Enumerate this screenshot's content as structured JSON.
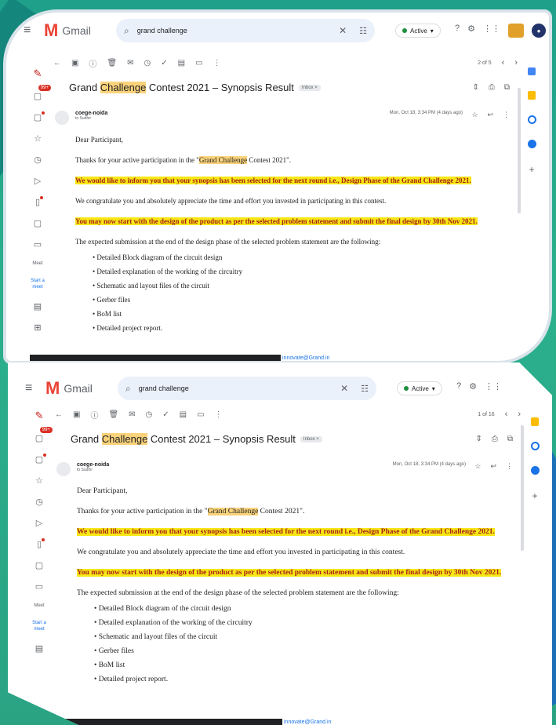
{
  "app": {
    "name": "Gmail"
  },
  "search": {
    "query": "grand challenge"
  },
  "status": {
    "label": "Active"
  },
  "toolbar": {
    "pager_top": "2 of 5",
    "pager_bottom": "1 of 16"
  },
  "rail": {
    "badge": "99+",
    "label1": "Meet",
    "label2": "Start a",
    "label3": "meet"
  },
  "email": {
    "subject_prefix": "Grand ",
    "subject_hl": "Challenge",
    "subject_rest": " Contest 2021 – Synopsis Result",
    "tag": "Inbox ×",
    "sender": "coege-noida",
    "to": "to Sudhir",
    "date_top": "Mon, Oct 18, 3:34 PM (4 days ago)",
    "date_bottom": "Mon, Oct 18, 3:34 PM (4 days ago)",
    "greeting": "Dear Participant,",
    "thanks_pre": "Thanks for your active participation in the \"",
    "thanks_hl": "Grand Challenge",
    "thanks_post": " Contest 2021\".",
    "selected": "We would like to inform you that your synopsis has been selected for the next round i.e., Design Phase of the Grand Challenge 2021.",
    "congrats": "We congratulate you and absolutely appreciate the time and effort you invested in participating in this contest.",
    "start": "You may now start with the design of the product as per the selected problem statement and submit the final design by 30th Nov 2021.",
    "expected": "The expected submission at the end of the design phase of the selected problem statement are the following:",
    "items": [
      "Detailed Block diagram of the circuit design",
      "Detailed explanation of the working of the circuitry",
      "Schematic and layout files of the circuit",
      "Gerber files",
      "BoM list",
      "Detailed project report."
    ],
    "link_tail": "innovate@Grand.in"
  }
}
